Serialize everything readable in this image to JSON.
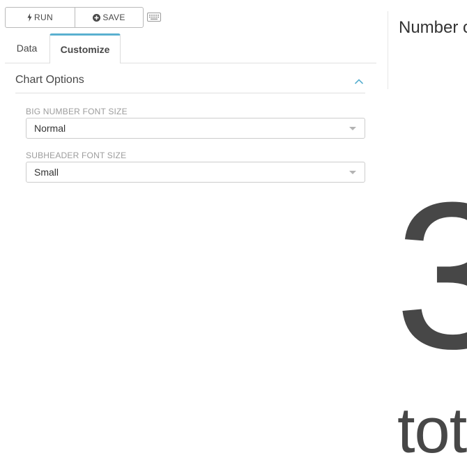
{
  "toolbar": {
    "run_label": "RUN",
    "save_label": "SAVE"
  },
  "tabs": [
    {
      "label": "Data",
      "active": false
    },
    {
      "label": "Customize",
      "active": true
    }
  ],
  "section": {
    "title": "Chart Options",
    "expanded": true,
    "accent_color": "#5ab0d0"
  },
  "fields": {
    "big_number_font_size": {
      "label": "BIG NUMBER FONT SIZE",
      "value": "Normal"
    },
    "subheader_font_size": {
      "label": "SUBHEADER FONT SIZE",
      "value": "Small"
    }
  },
  "preview": {
    "title": "Number o",
    "big_number": "3",
    "subheader": "tot"
  }
}
